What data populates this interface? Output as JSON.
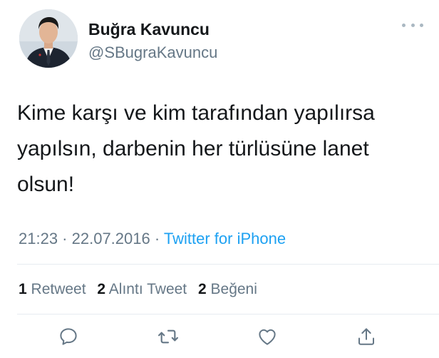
{
  "author": {
    "display_name": "Buğra Kavuncu",
    "handle": "@SBugraKavuncu",
    "avatar_icon": "avatar-photo"
  },
  "more_icon": "more-horizontal-icon",
  "tweet": {
    "text_line1": "Kime karşı ve kim tarafından yapılırsa",
    "text_line2": "yapılsın, darbenin her türlüsüne lanet",
    "text_line3": "olsun!"
  },
  "meta": {
    "time": "21:23",
    "separator1": " · ",
    "date": "22.07.2016",
    "separator2": " · ",
    "source": "Twitter for iPhone"
  },
  "stats": {
    "retweets_count": "1",
    "retweets_label": "Retweet",
    "quotes_count": "2",
    "quotes_label": "Alıntı Tweet",
    "likes_count": "2",
    "likes_label": "Beğeni"
  },
  "actions": [
    {
      "icon": "reply-icon"
    },
    {
      "icon": "retweet-icon"
    },
    {
      "icon": "like-icon"
    },
    {
      "icon": "share-icon"
    }
  ],
  "colors": {
    "primary_text": "#14171a",
    "secondary_text": "#657786",
    "link": "#1da1f2",
    "divider": "#e6ecf0"
  }
}
